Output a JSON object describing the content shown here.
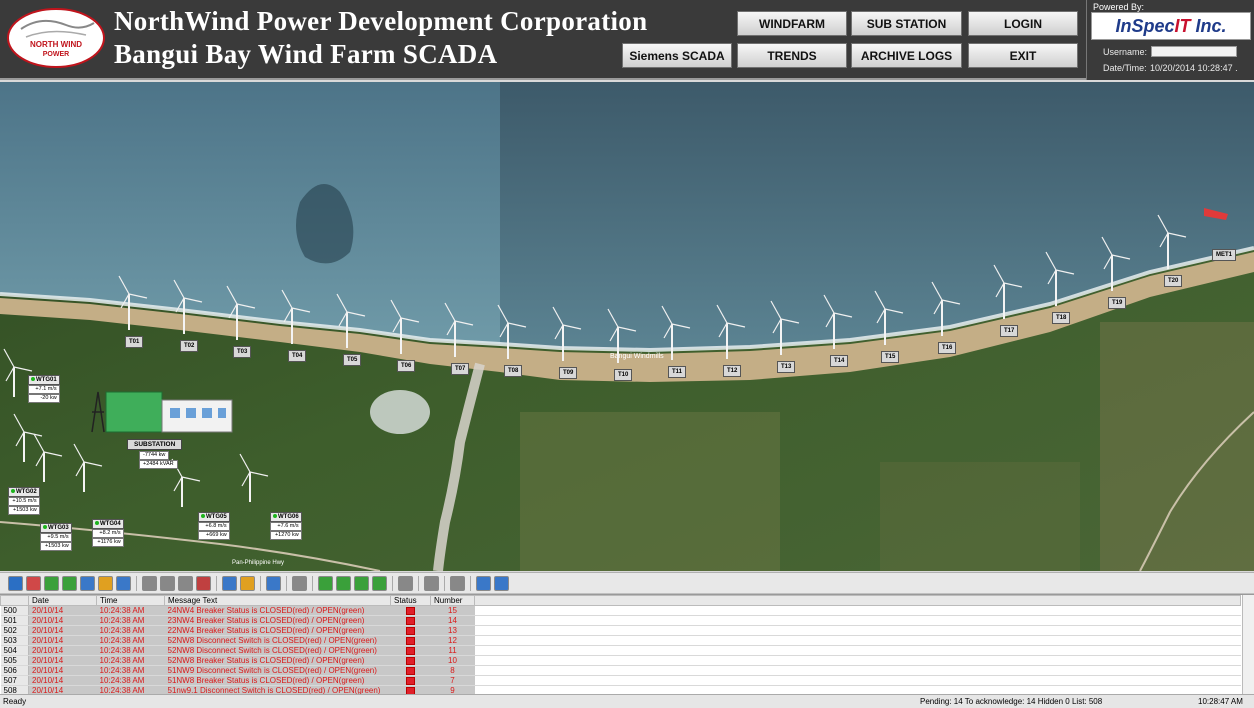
{
  "header": {
    "logo_text": [
      "NORTH WIND",
      "POWER"
    ],
    "title_line1": "NorthWind Power Development Corporation",
    "title_line2": "Bangui Bay Wind Farm SCADA",
    "buttons": {
      "windfarm": "WINDFARM",
      "substation": "SUB STATION",
      "login": "LOGIN",
      "siemens": "Siemens SCADA",
      "trends": "TRENDS",
      "archive": "ARCHIVE LOGS",
      "exit": "EXIT"
    },
    "powered_by": "Powered By:",
    "vendor_a": "InSpec",
    "vendor_b": "IT",
    "vendor_c": " Inc.",
    "username_label": "Username:",
    "username_value": "",
    "datetime_label": "Date/Time:",
    "datetime_value": "10/20/2014 10:28:47 ."
  },
  "map": {
    "turbines": [
      "T01",
      "T02",
      "T03",
      "T04",
      "T05",
      "T06",
      "T07",
      "T08",
      "T09",
      "T10",
      "T11",
      "T12",
      "T13",
      "T14",
      "T15",
      "T16",
      "T17",
      "T18",
      "T19",
      "T20"
    ],
    "met_label": "MET1",
    "place_label": "Bangui Windmills",
    "road_label": "Pan-Philippine Hwy",
    "substation": {
      "label": "SUBSTATION",
      "value1": "-7744 kw",
      "value2": "+2484 kVAR"
    },
    "wtg": [
      {
        "name": "WTG01",
        "v1": "+7.1 m/s",
        "v2": "-20 kw"
      },
      {
        "name": "WTG02",
        "v1": "+10.5 m/s",
        "v2": "+1503 kw"
      },
      {
        "name": "WTG03",
        "v1": "+9.5 m/s",
        "v2": "+1503 kw"
      },
      {
        "name": "WTG04",
        "v1": "+8.2 m/s",
        "v2": "+1176 kw"
      },
      {
        "name": "WTG05",
        "v1": "+6.8 m/s",
        "v2": "+669 kw"
      },
      {
        "name": "WTG06",
        "v1": "+7.6 m/s",
        "v2": "+1270 kw"
      }
    ],
    "colors": {
      "sea": "#4a7083",
      "beach": "#c8b48e",
      "land": "#3a5a2a"
    }
  },
  "toolbar": {
    "icons": [
      "help-icon",
      "filter-icon",
      "refresh-icon",
      "refresh-all-icon",
      "list-icon",
      "lock-icon",
      "chart-icon",
      "sep",
      "down-icon",
      "ack-icon",
      "ack-all-icon",
      "clear-icon",
      "sep",
      "properties-icon",
      "export-icon",
      "sep",
      "print-icon",
      "sep",
      "pin-icon",
      "sep",
      "move-first-icon",
      "move-prev-icon",
      "move-next-icon",
      "move-last-icon",
      "sep",
      "copy-icon",
      "sep",
      "sound-icon",
      "sep",
      "delete-icon",
      "sep",
      "calculator-icon",
      "clock-icon"
    ]
  },
  "alarms": {
    "columns": [
      "Date",
      "Time",
      "Message Text",
      "Status",
      "Number"
    ],
    "rows": [
      {
        "id": "500",
        "date": "20/10/14",
        "time": "10:24:38 AM",
        "msg": "24NW4 Breaker Status is CLOSED(red) / OPEN(green)",
        "num": "15"
      },
      {
        "id": "501",
        "date": "20/10/14",
        "time": "10:24:38 AM",
        "msg": "23NW4 Breaker Status is CLOSED(red) / OPEN(green)",
        "num": "14"
      },
      {
        "id": "502",
        "date": "20/10/14",
        "time": "10:24:38 AM",
        "msg": "22NW4 Breaker Status is CLOSED(red) / OPEN(green)",
        "num": "13"
      },
      {
        "id": "503",
        "date": "20/10/14",
        "time": "10:24:38 AM",
        "msg": "52NW8 Disconnect Switch is CLOSED(red) / OPEN(green)",
        "num": "12"
      },
      {
        "id": "504",
        "date": "20/10/14",
        "time": "10:24:38 AM",
        "msg": "52NW8 Disconnect Switch is CLOSED(red) / OPEN(green)",
        "num": "11"
      },
      {
        "id": "505",
        "date": "20/10/14",
        "time": "10:24:38 AM",
        "msg": "52NW8 Breaker Status is CLOSED(red) / OPEN(green)",
        "num": "10"
      },
      {
        "id": "506",
        "date": "20/10/14",
        "time": "10:24:38 AM",
        "msg": "51NW9 Disconnect Switch is CLOSED(red) / OPEN(green)",
        "num": "8"
      },
      {
        "id": "507",
        "date": "20/10/14",
        "time": "10:24:38 AM",
        "msg": "51NW8 Breaker Status is CLOSED(red) / OPEN(green)",
        "num": "7"
      },
      {
        "id": "508",
        "date": "20/10/14",
        "time": "10:24:38 AM",
        "msg": "51nw9.1 Disconnect Switch is CLOSED(red) / OPEN(green)",
        "num": "9"
      }
    ]
  },
  "status": {
    "ready": "Ready",
    "info": "Pending: 14  To acknowledge: 14  Hidden 0  List: 508",
    "time": "10:28:47 AM"
  }
}
